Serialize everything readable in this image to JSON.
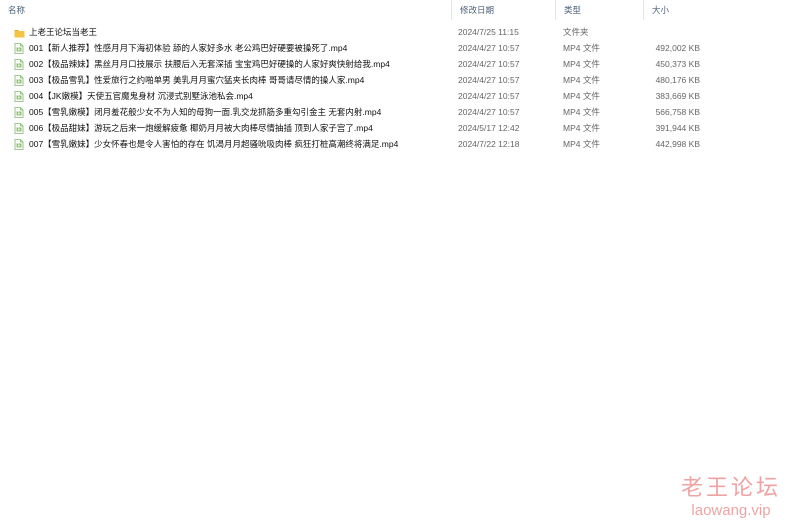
{
  "columns": {
    "name": "名称",
    "date": "修改日期",
    "type": "类型",
    "size": "大小"
  },
  "files": [
    {
      "name": "上老王论坛当老王",
      "date": "2024/7/25 11:15",
      "type": "文件夹",
      "size": "",
      "icon": "folder-icon"
    },
    {
      "name": "001【新人推荐】性感月月下海初体验 舔的人家好多水 老公鸡巴好硬要被操死了.mp4",
      "date": "2024/4/27 10:57",
      "type": "MP4 文件",
      "size": "492,002 KB",
      "icon": "video-file-icon"
    },
    {
      "name": "002【极品辣妹】黑丝月月口技展示 扶腰后入无套深插 宝宝鸡巴好硬操的人家好爽快射给我.mp4",
      "date": "2024/4/27 10:57",
      "type": "MP4 文件",
      "size": "450,373 KB",
      "icon": "video-file-icon"
    },
    {
      "name": "003【极品雪乳】性爱旅行之约啪单男 美乳月月蜜穴猛夹长肉棒 哥哥请尽情的操人家.mp4",
      "date": "2024/4/27 10:57",
      "type": "MP4 文件",
      "size": "480,176 KB",
      "icon": "video-file-icon"
    },
    {
      "name": "004【JK嫩模】天使五官魔鬼身材 沉浸式别墅泳池私会.mp4",
      "date": "2024/4/27 10:57",
      "type": "MP4 文件",
      "size": "383,669 KB",
      "icon": "video-file-icon"
    },
    {
      "name": "005【雪乳嫩模】闭月羞花般少女不为人知的母狗一面.乳交龙抓筋多重勾引金主 无套内射.mp4",
      "date": "2024/4/27 10:57",
      "type": "MP4 文件",
      "size": "566,758 KB",
      "icon": "video-file-icon"
    },
    {
      "name": "006【极品甜妹】游玩之后来一炮缓解疲惫 椰奶月月被大肉棒尽情抽插 顶到人家子宫了.mp4",
      "date": "2024/5/17 12:42",
      "type": "MP4 文件",
      "size": "391,944 KB",
      "icon": "video-file-icon"
    },
    {
      "name": "007【雪乳嫩妹】少女怀春也是令人害怕的存在 饥渴月月超骚吮吸肉棒 疯狂打桩高潮终将满足.mp4",
      "date": "2024/7/22 12:18",
      "type": "MP4 文件",
      "size": "442,998 KB",
      "icon": "video-file-icon"
    }
  ],
  "watermark": {
    "title": "老王论坛",
    "url": "laowang.vip"
  },
  "colors": {
    "folder": "#f4c542",
    "video_icon_border": "#7fb56a",
    "header_text": "#4c607a",
    "watermark": "#e25858"
  }
}
